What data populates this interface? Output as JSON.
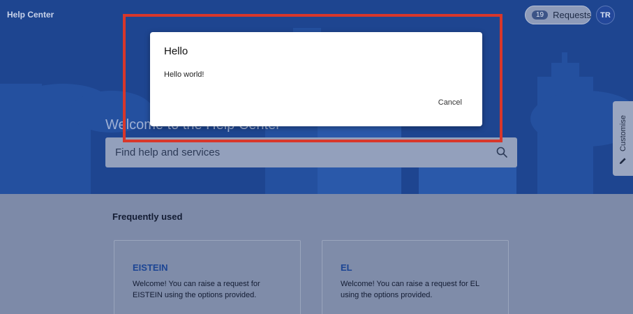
{
  "header": {
    "brand": "Help Center",
    "requests_count": "19",
    "requests_label": "Requests",
    "avatar_initials": "TR"
  },
  "hero": {
    "welcome": "Welcome to the Help Center",
    "search_placeholder": "Find help and services"
  },
  "side_tab": {
    "label": "Customise"
  },
  "frequently_used": {
    "title": "Frequently used",
    "cards": [
      {
        "title": "EISTEIN",
        "description": "Welcome! You can raise a request for EISTEIN using the options provided."
      },
      {
        "title": "EL",
        "description": "Welcome! You can raise a request for EL using the options provided."
      }
    ]
  },
  "modal": {
    "title": "Hello",
    "body": "Hello world!",
    "cancel_label": "Cancel"
  },
  "colors": {
    "hero_bg": "#1e4590",
    "highlight": "#d8372b",
    "link": "#1c4594"
  },
  "icons": {
    "search": "search-icon",
    "pencil": "pencil-icon"
  }
}
